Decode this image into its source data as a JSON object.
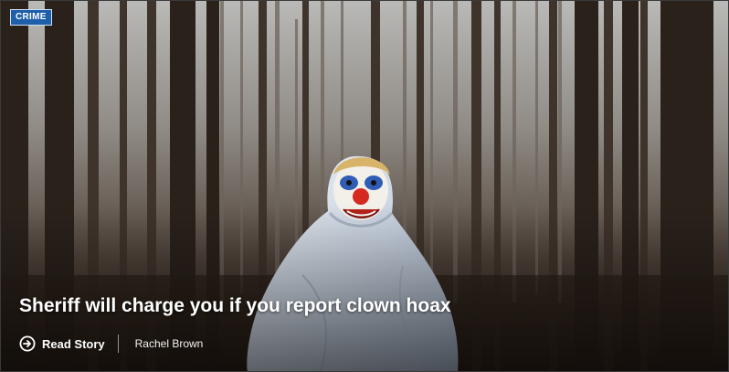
{
  "story": {
    "category": "CRIME",
    "headline": "Sheriff will charge you if you report clown hoax",
    "read_label": "Read Story",
    "author": "Rachel Brown",
    "accent_color": "#1f5ea8"
  },
  "icons": {
    "read": "arrow-circle-right-icon"
  }
}
